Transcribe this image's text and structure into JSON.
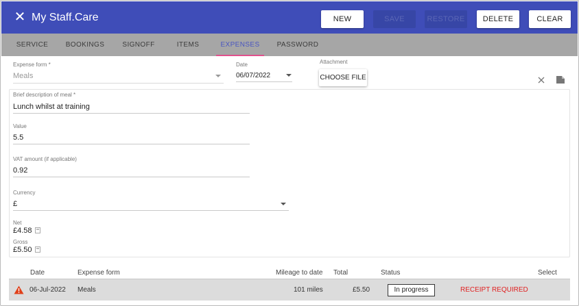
{
  "header": {
    "title": "My Staff.Care",
    "buttons": [
      {
        "label": "NEW",
        "enabled": true
      },
      {
        "label": "SAVE",
        "enabled": false
      },
      {
        "label": "RESTORE",
        "enabled": false
      },
      {
        "label": "DELETE",
        "enabled": true
      },
      {
        "label": "CLEAR",
        "enabled": true
      }
    ],
    "bg_color": "#3f4db8"
  },
  "tabs": [
    {
      "label": "SERVICE"
    },
    {
      "label": "BOOKINGS"
    },
    {
      "label": "SIGNOFF"
    },
    {
      "label": "ITEMS"
    },
    {
      "label": "EXPENSES",
      "selected": true
    },
    {
      "label": "PASSWORD"
    }
  ],
  "form": {
    "expense_form": {
      "label": "Expense form *",
      "value": "Meals"
    },
    "date": {
      "label": "Date",
      "value": "06/07/2022"
    },
    "attachment": {
      "label": "Attachment",
      "button": "CHOOSE FILE"
    },
    "description": {
      "label": "Brief description of meal *",
      "value": "Lunch whilst at training"
    },
    "value": {
      "label": "Value",
      "value": "5.5"
    },
    "vat": {
      "label": "VAT amount (if applicable)",
      "value": "0.92"
    },
    "currency": {
      "label": "Currency",
      "value": "£"
    },
    "net": {
      "label": "Net",
      "value": "£4.58"
    },
    "gross": {
      "label": "Gross",
      "value": "£5.50"
    }
  },
  "table": {
    "columns": [
      "Date",
      "Expense form",
      "Mileage to date",
      "Total",
      "Status",
      "Select"
    ],
    "rows": [
      {
        "warning_icon": "warning-icon",
        "date": "06-Jul-2022",
        "expense_form": "Meals",
        "mileage": "101 miles",
        "total": "£5.50",
        "status": "In progress",
        "select": "RECEIPT REQUIRED"
      }
    ]
  },
  "colors": {
    "accent": "#4a56c0",
    "tab_indicator": "#e0508c",
    "warning": "#e02020"
  }
}
